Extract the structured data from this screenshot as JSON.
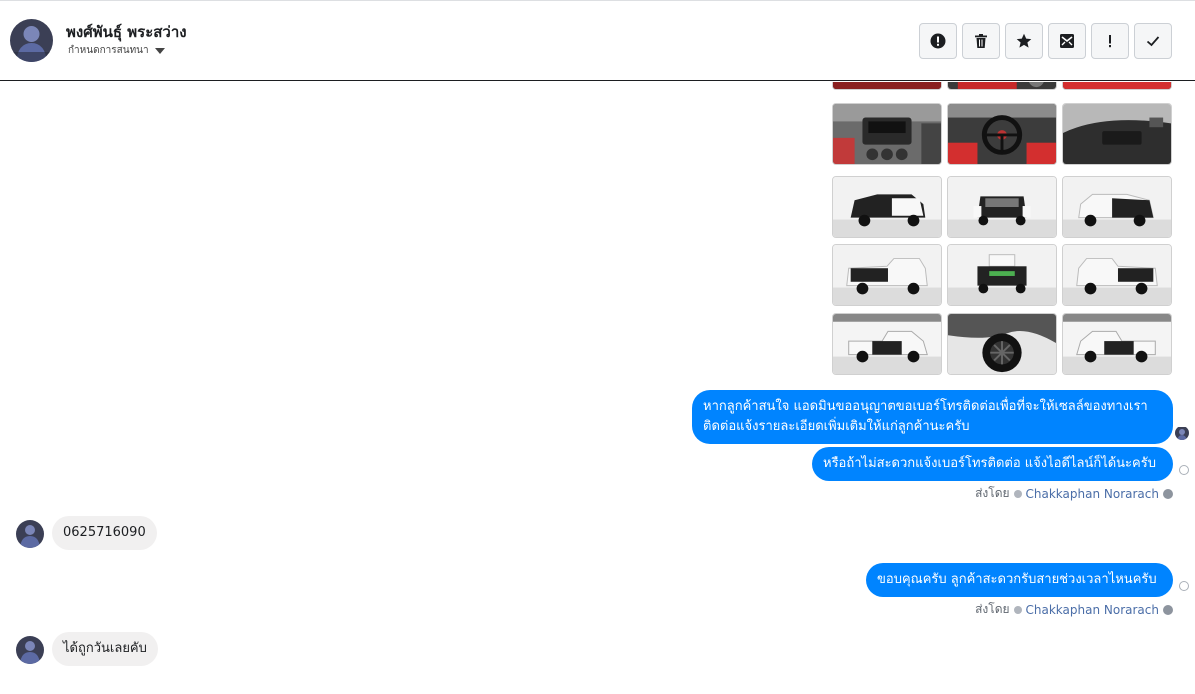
{
  "header": {
    "name": "พงศ์พันธุ์ พระสว่าง",
    "subtitle": "กำหนดการสนทนา",
    "toolbar": [
      {
        "name": "spam-alert-icon"
      },
      {
        "name": "trash-icon"
      },
      {
        "name": "star-icon"
      },
      {
        "name": "mark-unread-icon"
      },
      {
        "name": "exclamation-icon"
      },
      {
        "name": "check-icon"
      }
    ]
  },
  "messages": {
    "out_1": "หากลูกค้าสนใจ แอดมินขออนุญาตขอเบอร์โทรติดต่อเพื่อที่จะให้เซลล์ของทางเราติดต่อแจ้งรายละเอียดเพิ่มเติมให้แก่ลูกค้านะครับ",
    "out_2": "หรือถ้าไม่สะดวกแจ้งเบอร์โทรติดต่อ แจ้งไอดีไลน์ก็ได้นะครับ",
    "sent_by_1": {
      "prefix": "ส่งโดย",
      "agent": "Chakkaphan Norarach"
    },
    "in_1": "0625716090",
    "out_3": "ขอบคุณครับ ลูกค้าสะดวกรับสายช่วงเวลาไหนครับ",
    "sent_by_2": {
      "prefix": "ส่งโดย",
      "agent": "Chakkaphan Norarach"
    },
    "in_2": "ได้ถูกวันเลยคับ"
  },
  "colors": {
    "accent": "#0084ff",
    "incoming_bg": "#f1f0f0",
    "agent_link": "#4b6ea8"
  }
}
